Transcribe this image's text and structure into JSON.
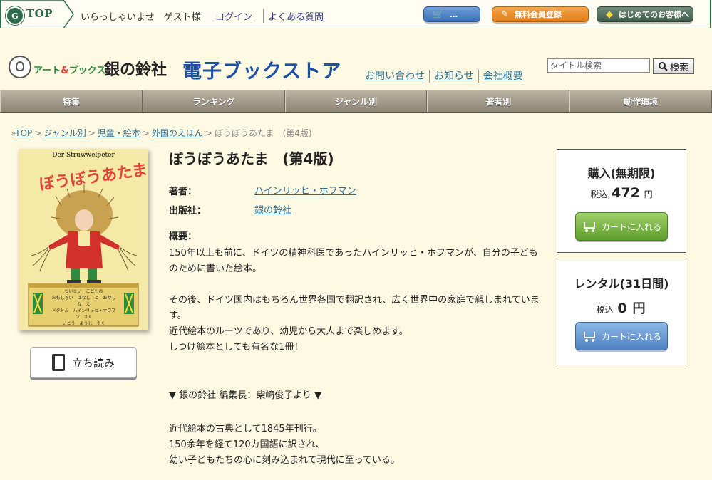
{
  "topbar": {
    "top_label": "TOP",
    "greeting": "いらっしゃいませ　ゲスト様",
    "login": "ログイン",
    "faq": "よくある質問",
    "cart_label": "…",
    "register_label": "無料会員登録",
    "first_time_label": "はじめてのお客様へ"
  },
  "header": {
    "brand_small_a": "アート",
    "brand_small_amp": "&",
    "brand_small_b": "ブックス",
    "brand_name": "銀の鈴社",
    "store_name": "電子ブックストア",
    "links": [
      "お問い合わせ",
      "お知らせ",
      "会社概要"
    ],
    "search_placeholder": "タイトル検索",
    "search_button": "検索"
  },
  "nav": [
    "特集",
    "ランキング",
    "ジャンル別",
    "著者別",
    "動作環境"
  ],
  "breadcrumb": {
    "items": [
      "TOP",
      "ジャンル別",
      "児童・絵本",
      "外国のえほん"
    ],
    "current": "ぼうぼうあたま　(第4版)"
  },
  "cover": {
    "title_de": "Der Struwwelpeter",
    "title_jp": "ぼうぼうあたま",
    "credits": [
      "ちいさい　こどもの",
      "おもしろい　はなし　と　おかしな　え",
      "ドクトル　ハインリッヒ・ホフマン　さく",
      "いとう　ようじ　やく"
    ]
  },
  "preview_button": "立ち読み",
  "book": {
    "title": "ぼうぼうあたま　(第4版)",
    "author_label": "著者：",
    "author": "ハインリッヒ・ホフマン",
    "publisher_label": "出版社：",
    "publisher": "銀の鈴社",
    "summary_label": "概要：",
    "summary_1": "150年以上も前に、ドイツの精神科医であったハインリッヒ・ホフマンが、自分の子どものために書いた絵本。",
    "summary_2": "その後、ドイツ国内はもちろん世界各国で翻訳され、広く世界中の家庭で親しまれています。",
    "summary_3": "近代絵本のルーツであり、幼児から大人まで楽しめます。",
    "summary_4": "しつけ絵本としても有名な1冊！",
    "editor_heading": "▼ 銀の鈴社 編集長：柴崎俊子より ▼",
    "editor_1": "近代絵本の古典として1845年刊行。",
    "editor_2": "150余年を経て120カ国語に訳され、",
    "editor_3": "幼い子どもたちの心に刻み込まれて現代に至っている。"
  },
  "purchase": {
    "buy_heading": "購入(無期限)",
    "tax_label": "税込",
    "buy_price": "472",
    "yen": "円",
    "cart_label": "カートに入れる",
    "rent_heading": "レンタル(31日間)",
    "rent_price": "0",
    "rent_yen": "円"
  },
  "colors": {
    "page_bg": "#fdf9e3",
    "brand_green": "#2f6b4e",
    "store_blue": "#1f4fa0",
    "link": "#2b6f93",
    "register_orange": "#e27c16",
    "cart_green": "#5f9e2c",
    "cart_blue": "#4f82c2"
  }
}
